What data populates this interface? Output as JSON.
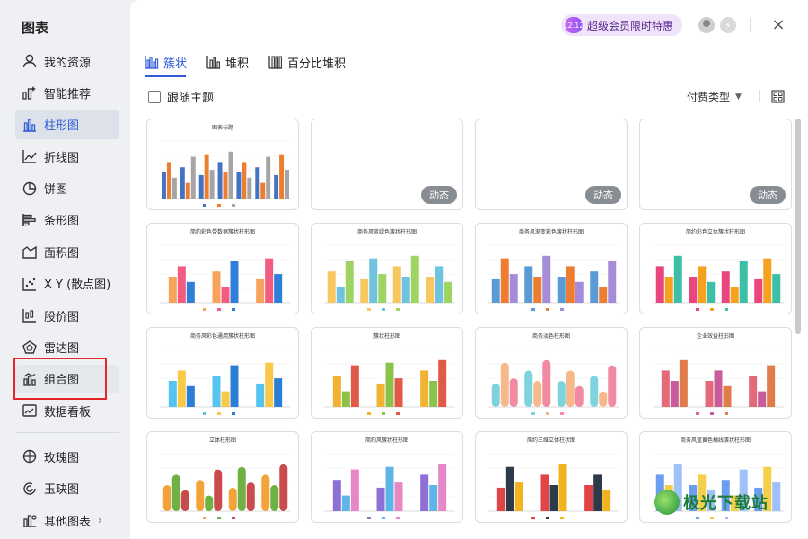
{
  "sidebar": {
    "title": "图表",
    "items": [
      {
        "label": "我的资源",
        "icon": "user-icon"
      },
      {
        "label": "智能推荐",
        "icon": "smart-recommend-icon"
      },
      {
        "label": "柱形图",
        "icon": "column-chart-icon",
        "active": true
      },
      {
        "label": "折线图",
        "icon": "line-chart-icon"
      },
      {
        "label": "饼图",
        "icon": "pie-chart-icon"
      },
      {
        "label": "条形图",
        "icon": "bar-chart-icon"
      },
      {
        "label": "面积图",
        "icon": "area-chart-icon"
      },
      {
        "label": "X Y (散点图)",
        "icon": "scatter-chart-icon"
      },
      {
        "label": "股价图",
        "icon": "stock-chart-icon"
      },
      {
        "label": "雷达图",
        "icon": "radar-chart-icon"
      },
      {
        "label": "组合图",
        "icon": "combo-chart-icon",
        "highlighted": true
      },
      {
        "label": "数据看板",
        "icon": "dashboard-icon"
      }
    ],
    "extra_items": [
      {
        "label": "玫瑰图",
        "icon": "rose-chart-icon"
      },
      {
        "label": "玉玦图",
        "icon": "jade-ring-chart-icon"
      },
      {
        "label": "其他图表",
        "icon": "other-chart-icon",
        "chevron": "›"
      }
    ]
  },
  "header": {
    "vip_badge": "12.12",
    "vip_label": "超级会员限时特惠",
    "close": "×"
  },
  "tabs": [
    {
      "label": "簇状",
      "active": true
    },
    {
      "label": "堆积"
    },
    {
      "label": "百分比堆积"
    }
  ],
  "toolbar": {
    "follow_theme": "跟随主题",
    "pay_type": "付费类型",
    "pay_caret": "▼"
  },
  "cards": [
    {
      "title": "图表标题",
      "style": "basic",
      "dynamic": ""
    },
    {
      "title": "",
      "style": "blank",
      "dynamic": "动态"
    },
    {
      "title": "",
      "style": "blank",
      "dynamic": "动态"
    },
    {
      "title": "",
      "style": "blank",
      "dynamic": "动态"
    },
    {
      "title": "简约彩色带数据簇状柱形图",
      "style": "c1",
      "dynamic": ""
    },
    {
      "title": "商务风蓝绿色簇状柱形图",
      "style": "c2",
      "dynamic": ""
    },
    {
      "title": "商务风渐变彩色簇状柱形图",
      "style": "c3",
      "dynamic": ""
    },
    {
      "title": "简约彩色立体簇状柱形图",
      "style": "c4",
      "dynamic": ""
    },
    {
      "title": "商务风彩色通用簇状柱形图",
      "style": "c5",
      "dynamic": ""
    },
    {
      "title": "簇状柱形图",
      "style": "c6",
      "dynamic": ""
    },
    {
      "title": "商务淡色柱形图",
      "style": "c7",
      "dynamic": ""
    },
    {
      "title": "企业效益柱形图",
      "style": "c8",
      "dynamic": ""
    },
    {
      "title": "立体柱形图",
      "style": "c9",
      "dynamic": ""
    },
    {
      "title": "简约风簇状柱形图",
      "style": "c10",
      "dynamic": ""
    },
    {
      "title": "简约三维立体柱状图",
      "style": "c11",
      "dynamic": ""
    },
    {
      "title": "商务风蓝黄色横线簇状柱形图",
      "style": "c12",
      "dynamic": ""
    }
  ],
  "watermark": {
    "text": "极光下载站",
    "url": "www.xz7.com"
  },
  "colors": {
    "accent": "#2f5bd7",
    "highlight_border": "#e5262b"
  }
}
